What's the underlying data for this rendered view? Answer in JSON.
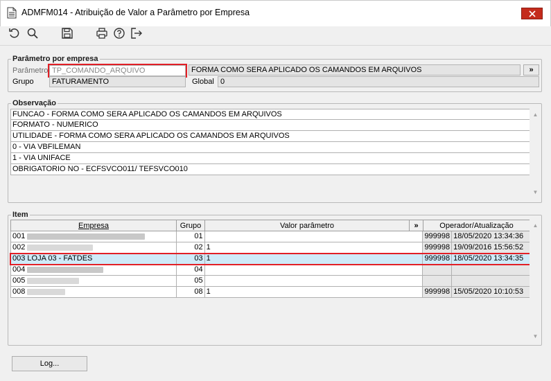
{
  "window": {
    "title": "ADMFM014 - Atribuição de Valor a Parâmetro por Empresa",
    "icons": [
      "document-icon",
      "close-icon"
    ]
  },
  "toolbar": {
    "icons": [
      "refresh-icon",
      "search-icon",
      "save-icon",
      "print-icon",
      "help-icon",
      "exit-icon"
    ]
  },
  "parametro_por_empresa": {
    "title": "Parâmetro por empresa",
    "parametro_label": "Parâmetro",
    "parametro_value": "TP_COMANDO_ARQUIVO",
    "parametro_description": "FORMA COMO SERA APLICADO OS CAMANDOS EM ARQUIVOS",
    "expand_button": "»",
    "grupo_label": "Grupo",
    "grupo_value": "FATURAMENTO",
    "global_label": "Global",
    "global_value": "0"
  },
  "observacao": {
    "title": "Observação",
    "lines": [
      "FUNCAO - FORMA COMO SERA APLICADO OS CAMANDOS EM ARQUIVOS",
      "FORMATO - NUMERICO",
      "UTILIDADE - FORMA COMO SERA APLICADO OS CAMANDOS EM ARQUIVOS",
      "0 - VIA VBFILEMAN",
      "1 - VIA UNIFACE",
      "OBRIGATORIO NO - ECFSVCO011/ TEFSVCO010"
    ]
  },
  "item": {
    "title": "Item",
    "headers": {
      "empresa": "Empresa",
      "grupo": "Grupo",
      "valor": "Valor parâmetro",
      "expand": "»",
      "operador": "Operador/Atualização"
    },
    "rows": [
      {
        "code": "001",
        "empresa": "",
        "grupo": "01",
        "valor": "",
        "operador": "999998",
        "data": "18/05/2020 13:34:36",
        "selected": false
      },
      {
        "code": "002",
        "empresa": "",
        "grupo": "02",
        "valor": "1",
        "operador": "999998",
        "data": "19/09/2016 15:56:52",
        "selected": false
      },
      {
        "code": "003",
        "empresa": "LOJA 03 - FATDES",
        "grupo": "03",
        "valor": "1",
        "operador": "999998",
        "data": "18/05/2020 13:34:35",
        "selected": true
      },
      {
        "code": "004",
        "empresa": "",
        "grupo": "04",
        "valor": "",
        "operador": "",
        "data": "",
        "selected": false
      },
      {
        "code": "005",
        "empresa": "",
        "grupo": "05",
        "valor": "",
        "operador": "",
        "data": "",
        "selected": false
      },
      {
        "code": "008",
        "empresa": "",
        "grupo": "08",
        "valor": "1",
        "operador": "999998",
        "data": "15/05/2020 10:10:53",
        "selected": false
      }
    ]
  },
  "footer": {
    "log_button": "Log..."
  },
  "colors": {
    "highlight_border": "#e21f26",
    "selected_row": "#cfeaf8",
    "close_button": "#c42b1c"
  }
}
